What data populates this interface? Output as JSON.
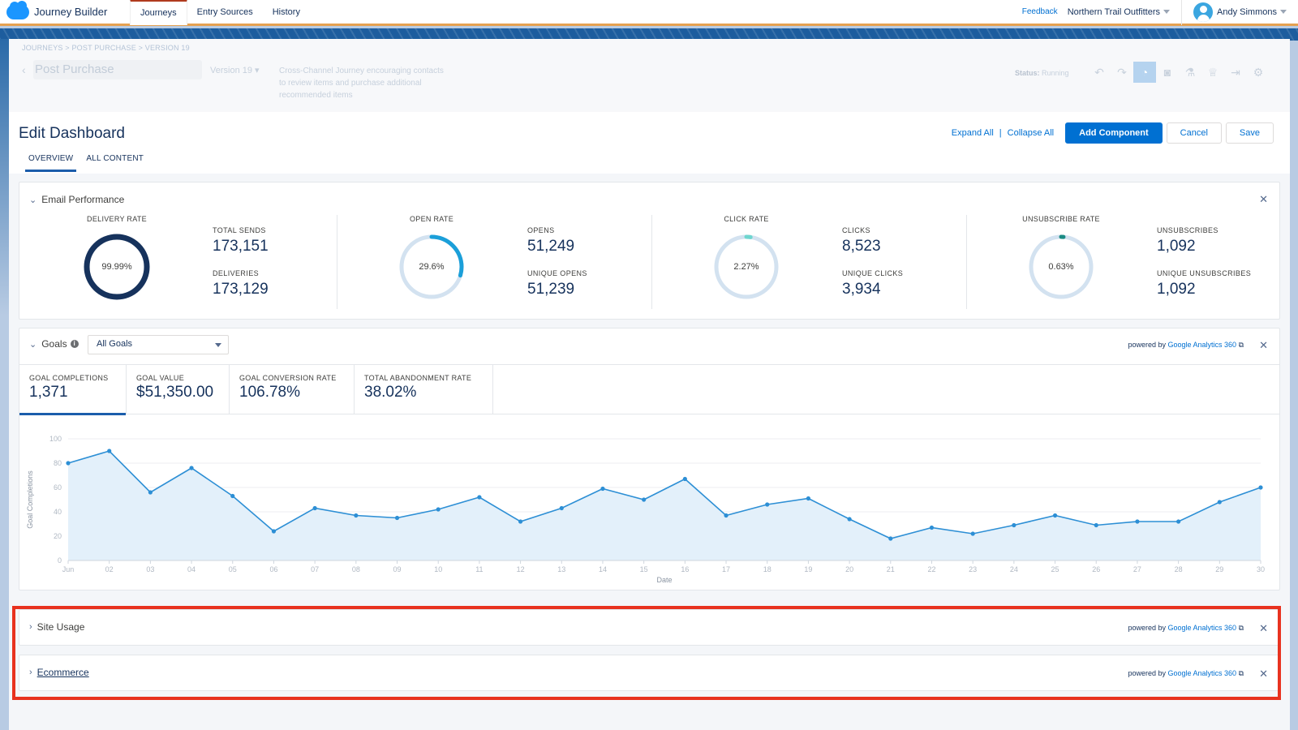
{
  "topnav": {
    "app_name": "Journey Builder",
    "tabs": [
      {
        "label": "Journeys",
        "active": true
      },
      {
        "label": "Entry Sources",
        "active": false
      },
      {
        "label": "History",
        "active": false
      }
    ],
    "feedback": "Feedback",
    "org": "Northern Trail Outfitters",
    "user": "Andy Simmons"
  },
  "journey": {
    "breadcrumb": "JOURNEYS > POST PURCHASE > VERSION 19",
    "name": "Post Purchase",
    "version": "Version 19",
    "description": "Cross-Channel Journey encouraging contacts to review items and purchase additional recommended items",
    "status_label": "Status:",
    "status_value": "Running",
    "icons": [
      "undo-icon",
      "redo-icon",
      "dashboard-icon",
      "camera-icon",
      "test-icon",
      "goal-trophy-icon",
      "exit-icon",
      "settings-gear-icon"
    ]
  },
  "edit": {
    "title": "Edit Dashboard",
    "tabs": [
      {
        "label": "OVERVIEW",
        "active": true
      },
      {
        "label": "ALL CONTENT",
        "active": false
      }
    ],
    "expand_all": "Expand All",
    "separator": "|",
    "collapse_all": "Collapse All",
    "add_component": "Add Component",
    "cancel": "Cancel",
    "save": "Save"
  },
  "email": {
    "title": "Email Performance",
    "groups": [
      {
        "rate_label": "DELIVERY RATE",
        "rate": "99.99%",
        "rate_value": 99.99,
        "color": "#16325c",
        "stat1_label": "TOTAL SENDS",
        "stat1": "173,151",
        "stat2_label": "DELIVERIES",
        "stat2": "173,129"
      },
      {
        "rate_label": "OPEN RATE",
        "rate": "29.6%",
        "rate_value": 29.6,
        "color": "#1b9fd9",
        "stat1_label": "OPENS",
        "stat1": "51,249",
        "stat2_label": "UNIQUE OPENS",
        "stat2": "51,239"
      },
      {
        "rate_label": "CLICK RATE",
        "rate": "2.27%",
        "rate_value": 2.27,
        "color": "#6fd6cf",
        "stat1_label": "CLICKS",
        "stat1": "8,523",
        "stat2_label": "UNIQUE CLICKS",
        "stat2": "3,934"
      },
      {
        "rate_label": "UNSUBSCRIBE RATE",
        "rate": "0.63%",
        "rate_value": 0.63,
        "color": "#1a8b84",
        "stat1_label": "UNSUBSCRIBES",
        "stat1": "1,092",
        "stat2_label": "UNIQUE UNSUBSCRIBES",
        "stat2": "1,092"
      }
    ],
    "track_color": "#d3e2f0"
  },
  "goals": {
    "title": "Goals",
    "info": "i",
    "select_value": "All Goals",
    "powered_prefix": "powered by",
    "powered_link": "Google Analytics 360",
    "kpis": [
      {
        "label": "GOAL COMPLETIONS",
        "value": "1,371",
        "active": true
      },
      {
        "label": "GOAL VALUE",
        "value": "$51,350.00",
        "active": false
      },
      {
        "label": "GOAL CONVERSION RATE",
        "value": "106.78%",
        "active": false
      },
      {
        "label": "TOTAL ABANDONMENT RATE",
        "value": "38.02%",
        "active": false
      }
    ]
  },
  "chart_data": {
    "type": "area",
    "title": "",
    "xlabel": "Date",
    "ylabel": "Goal Completions",
    "ylim": [
      0,
      100
    ],
    "yticks": [
      0,
      20,
      40,
      60,
      80,
      100
    ],
    "grid": true,
    "legend": "none",
    "categories": [
      "Jun",
      "02",
      "03",
      "04",
      "05",
      "06",
      "07",
      "08",
      "09",
      "10",
      "11",
      "12",
      "13",
      "14",
      "15",
      "16",
      "17",
      "18",
      "19",
      "20",
      "21",
      "22",
      "23",
      "24",
      "25",
      "26",
      "27",
      "28",
      "29",
      "30"
    ],
    "series": [
      {
        "name": "Goal Completions",
        "color": "#2d8fd5",
        "values": [
          80,
          90,
          56,
          76,
          53,
          24,
          43,
          37,
          35,
          42,
          52,
          32,
          43,
          59,
          50,
          67,
          37,
          46,
          51,
          34,
          18,
          27,
          22,
          29,
          37,
          29,
          32,
          32,
          48,
          60
        ]
      }
    ]
  },
  "site_usage": {
    "title": "Site Usage",
    "powered_prefix": "powered by",
    "powered_link": "Google Analytics 360"
  },
  "ecommerce": {
    "title": "Ecommerce",
    "powered_prefix": "powered by",
    "powered_link": "Google Analytics 360"
  },
  "close_glyph": "✕",
  "ext_glyph": "⧉"
}
